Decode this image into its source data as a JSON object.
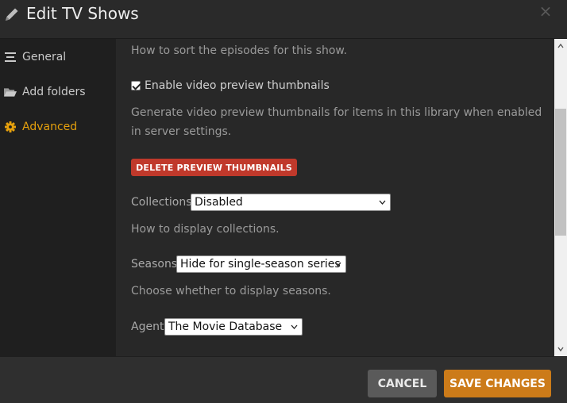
{
  "dialog": {
    "title": "Edit TV Shows",
    "close_label": "×"
  },
  "sidebar": {
    "items": [
      {
        "label": "General",
        "icon": "list-icon"
      },
      {
        "label": "Add folders",
        "icon": "folder-icon"
      },
      {
        "label": "Advanced",
        "icon": "gear-icon",
        "active": true
      }
    ]
  },
  "content": {
    "sort_help": "How to sort the episodes for this show.",
    "thumbnails_checkbox": {
      "label": "Enable video preview thumbnails",
      "checked": true
    },
    "thumbnails_help": "Generate video preview thumbnails for items in this library when enabled in server settings.",
    "delete_thumbnails_button": "DELETE PREVIEW THUMBNAILS",
    "collections": {
      "label": "Collections",
      "value": "Disabled",
      "help": "How to display collections."
    },
    "seasons": {
      "label": "Seasons",
      "value": "Hide for single-season series",
      "help": "Choose whether to display seasons."
    },
    "agent": {
      "label": "Agent",
      "value": "The Movie Database"
    }
  },
  "footer": {
    "cancel_label": "CANCEL",
    "save_label": "SAVE CHANGES"
  },
  "colors": {
    "accent": "#e5a00d",
    "save_button": "#cc7b19",
    "danger_button": "#c0392b",
    "cancel_button": "#5a5a5a"
  }
}
